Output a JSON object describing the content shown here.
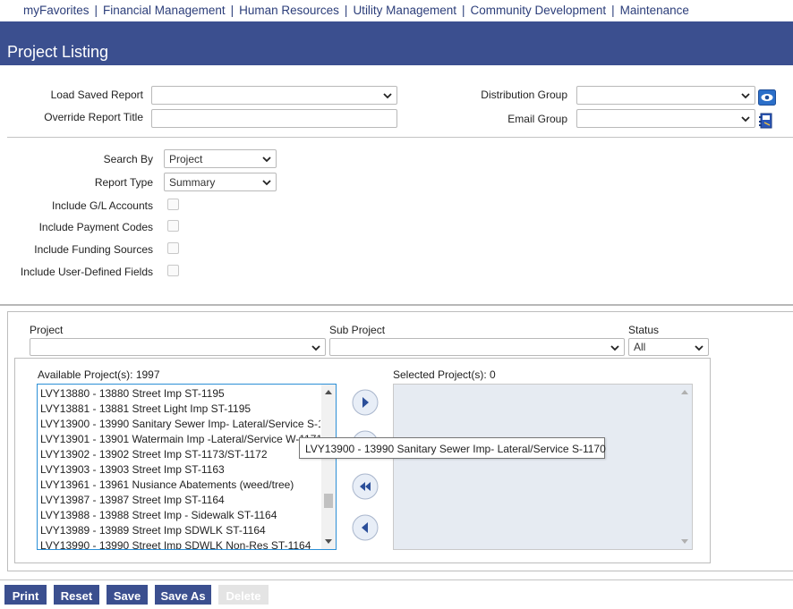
{
  "nav": {
    "items": [
      "myFavorites",
      "Financial Management",
      "Human Resources",
      "Utility Management",
      "Community Development",
      "Maintenance"
    ],
    "separator": "|"
  },
  "header": {
    "title": "Project Listing"
  },
  "report": {
    "load_saved_label": "Load Saved Report",
    "load_saved_value": "",
    "override_title_label": "Override Report Title",
    "override_title_value": "",
    "distribution_group_label": "Distribution Group",
    "distribution_group_value": "",
    "email_group_label": "Email Group",
    "email_group_value": ""
  },
  "options": {
    "search_by_label": "Search By",
    "search_by_value": "Project",
    "report_type_label": "Report Type",
    "report_type_value": "Summary",
    "checkboxes": [
      {
        "label": "Include G/L Accounts",
        "checked": false
      },
      {
        "label": "Include Payment Codes",
        "checked": false
      },
      {
        "label": "Include Funding Sources",
        "checked": false
      },
      {
        "label": "Include User-Defined Fields",
        "checked": false
      }
    ]
  },
  "filters": {
    "project_label": "Project",
    "project_value": "",
    "sub_project_label": "Sub Project",
    "sub_project_value": "",
    "status_label": "Status",
    "status_value": "All"
  },
  "available": {
    "label": "Available Project(s): 1997",
    "items": [
      "LVY13880 - 13880 Street Imp ST-1195",
      "LVY13881 - 13881 Street Light Imp ST-1195",
      "LVY13900 - 13990 Sanitary Sewer Imp- Lateral/Service S-1170",
      "LVY13901 - 13901 Watermain Imp -Lateral/Service W-1171",
      "LVY13902 - 13902 Street Imp ST-1173/ST-1172",
      "LVY13903 - 13903 Street Imp ST-1163",
      "LVY13961 - 13961 Nusiance Abatements (weed/tree)",
      "LVY13987 - 13987 Street Imp ST-1164",
      "LVY13988 - 13988 Street Imp - Sidewalk ST-1164",
      "LVY13989 - 13989 Street Imp SDWLK ST-1164",
      "LVY13990 - 13990 Street Imp SDWLK Non-Res ST-1164"
    ]
  },
  "selected": {
    "label": "Selected Project(s): 0"
  },
  "tooltip": {
    "text": "LVY13900 - 13990 Sanitary Sewer Imp- Lateral/Service S-1170"
  },
  "buttons": {
    "print": "Print",
    "reset": "Reset",
    "save": "Save",
    "save_as": "Save As",
    "delete": "Delete"
  },
  "icons": {
    "move_right": "chevron-right-circle-icon",
    "move_all_right": "double-chevron-right-circle-icon",
    "move_all_left": "double-chevron-left-circle-icon",
    "move_left": "chevron-left-circle-icon",
    "view_distribution": "eye-icon",
    "email_book": "address-book-icon"
  },
  "colors": {
    "brand": "#3b4f8f",
    "nav_link": "#2c3e7a",
    "focus_border": "#2b8fd6"
  }
}
